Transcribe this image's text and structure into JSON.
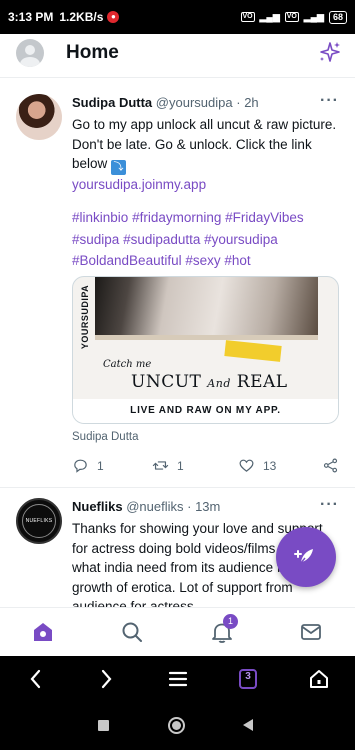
{
  "status_bar": {
    "time": "3:13 PM",
    "speed": "1.2KB/s",
    "battery": "68"
  },
  "header": {
    "title": "Home"
  },
  "tweets": [
    {
      "name": "Sudipa Dutta",
      "handle": "@yoursudipa",
      "separator": "·",
      "time": "2h",
      "text": "Go to my app unlock all uncut & raw picture. Don't be late. Go & unlock. Click the link below",
      "link": "yoursudipa.joinmy.app",
      "hashtags": [
        "#linkinbio",
        "#fridaymorning",
        "#FridayVibes",
        "#sudipa",
        "#sudipadutta",
        "#yoursudipa",
        "#BoldandBeautiful",
        "#sexy",
        "#hot"
      ],
      "card": {
        "side_text": "YOURSUDIPA",
        "catch": "Catch me",
        "uncut": "UNCUT",
        "and": "And",
        "real": "REAL",
        "footer": "LIVE AND RAW ON MY APP."
      },
      "card_source": "Sudipa Dutta",
      "replies": "1",
      "retweets": "1",
      "likes": "13"
    },
    {
      "name": "Nuefliks",
      "handle": "@nuefliks",
      "separator": "·",
      "time": "13m",
      "avatar_text": "NUEFLIKS",
      "text": "Thanks for showing your love and support for actress doing bold videos/films. That's what india need from its audience for the growth of erotica. Lot of support from audience for actress."
    }
  ],
  "bottom_nav": {
    "notification_count": "1"
  },
  "browser_bar": {
    "tab_count": "3"
  },
  "colors": {
    "accent": "#794bc4",
    "text_secondary": "#536471"
  }
}
